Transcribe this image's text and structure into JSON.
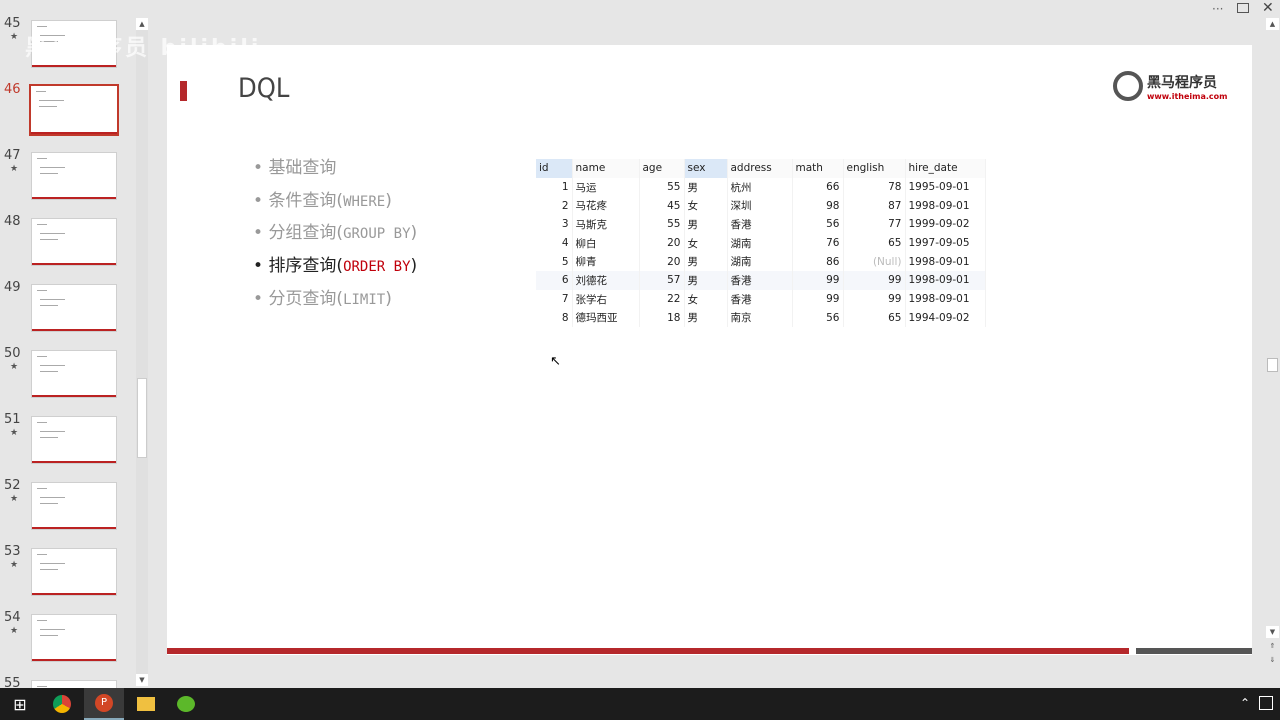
{
  "window": {
    "more_label": "···",
    "close_label": "✕"
  },
  "thumbnails": [
    {
      "num": "45",
      "star": true
    },
    {
      "num": "46",
      "star": false,
      "selected": true
    },
    {
      "num": "47",
      "star": true
    },
    {
      "num": "48",
      "star": false
    },
    {
      "num": "49",
      "star": false
    },
    {
      "num": "50",
      "star": true
    },
    {
      "num": "51",
      "star": true
    },
    {
      "num": "52",
      "star": true
    },
    {
      "num": "53",
      "star": true
    },
    {
      "num": "54",
      "star": true
    },
    {
      "num": "55",
      "star": false
    }
  ],
  "watermark": "黑马程序员 bilibili",
  "slide": {
    "title": "DQL",
    "logo": {
      "name": "黑马程序员",
      "url": "www.itheima.com"
    },
    "bullets": [
      {
        "text": "基础查询",
        "code": ""
      },
      {
        "text": "条件查询(",
        "code": "WHERE",
        "end": ")"
      },
      {
        "text": "分组查询(",
        "code": "GROUP BY",
        "end": ")"
      },
      {
        "text": "排序查询(",
        "code": "ORDER BY",
        "end": ")"
      },
      {
        "text": "分页查询(",
        "code": "LIMIT",
        "end": ")"
      }
    ],
    "table": {
      "headers": [
        "id",
        "name",
        "age",
        "sex",
        "address",
        "math",
        "english",
        "hire_date"
      ],
      "rows": [
        [
          "1",
          "马运",
          "55",
          "男",
          "杭州",
          "66",
          "78",
          "1995-09-01"
        ],
        [
          "2",
          "马花疼",
          "45",
          "女",
          "深圳",
          "98",
          "87",
          "1998-09-01"
        ],
        [
          "3",
          "马斯克",
          "55",
          "男",
          "香港",
          "56",
          "77",
          "1999-09-02"
        ],
        [
          "4",
          "柳白",
          "20",
          "女",
          "湖南",
          "76",
          "65",
          "1997-09-05"
        ],
        [
          "5",
          "柳青",
          "20",
          "男",
          "湖南",
          "86",
          "(Null)",
          "1998-09-01"
        ],
        [
          "6",
          "刘德花",
          "57",
          "男",
          "香港",
          "99",
          "99",
          "1998-09-01"
        ],
        [
          "7",
          "张学右",
          "22",
          "女",
          "香港",
          "99",
          "99",
          "1998-09-01"
        ],
        [
          "8",
          "德玛西亚",
          "18",
          "男",
          "南京",
          "56",
          "65",
          "1994-09-02"
        ]
      ]
    }
  },
  "colors": {
    "accent": "#b5282b",
    "code_red": "#c0000b"
  }
}
